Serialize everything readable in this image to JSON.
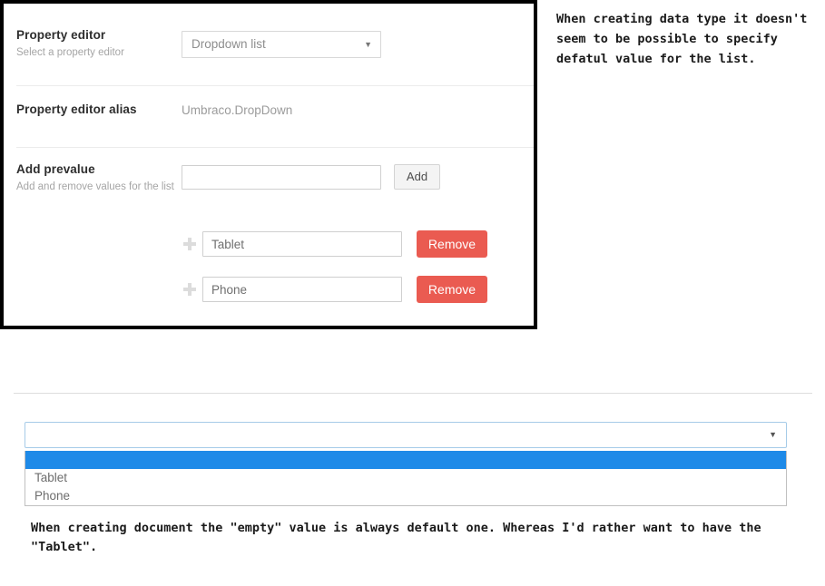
{
  "editor_panel": {
    "rows": [
      {
        "label": "Property editor",
        "description": "Select a property editor",
        "select_value": "Dropdown list",
        "caret": "▼"
      },
      {
        "label": "Property editor alias",
        "value": "Umbraco.DropDown"
      },
      {
        "label": "Add prevalue",
        "description": "Add and remove values for the list",
        "input_value": "",
        "input_placeholder": "",
        "add_button": "Add"
      }
    ],
    "prevalues": [
      {
        "value": "Tablet",
        "remove_label": "Remove",
        "handle_icon": "drag-move-icon"
      },
      {
        "value": "Phone",
        "remove_label": "Remove",
        "handle_icon": "drag-move-icon"
      }
    ],
    "colors": {
      "remove_button": "#ea5b51",
      "panel_border": "#000000"
    }
  },
  "annotations": {
    "top": "When creating data type it doesn't seem to be possible to specify defatul value for the list.",
    "bottom": "When creating document the \"empty\" value is always default one. Whereas I'd rather want to have the \"Tablet\"."
  },
  "open_dropdown": {
    "selected_value": "",
    "caret": "▼",
    "options": [
      {
        "label": "",
        "selected": true
      },
      {
        "label": "Tablet",
        "selected": false
      },
      {
        "label": "Phone",
        "selected": false
      }
    ],
    "colors": {
      "highlight": "#1e8ae8",
      "focus_border": "#a6cbe8"
    }
  }
}
